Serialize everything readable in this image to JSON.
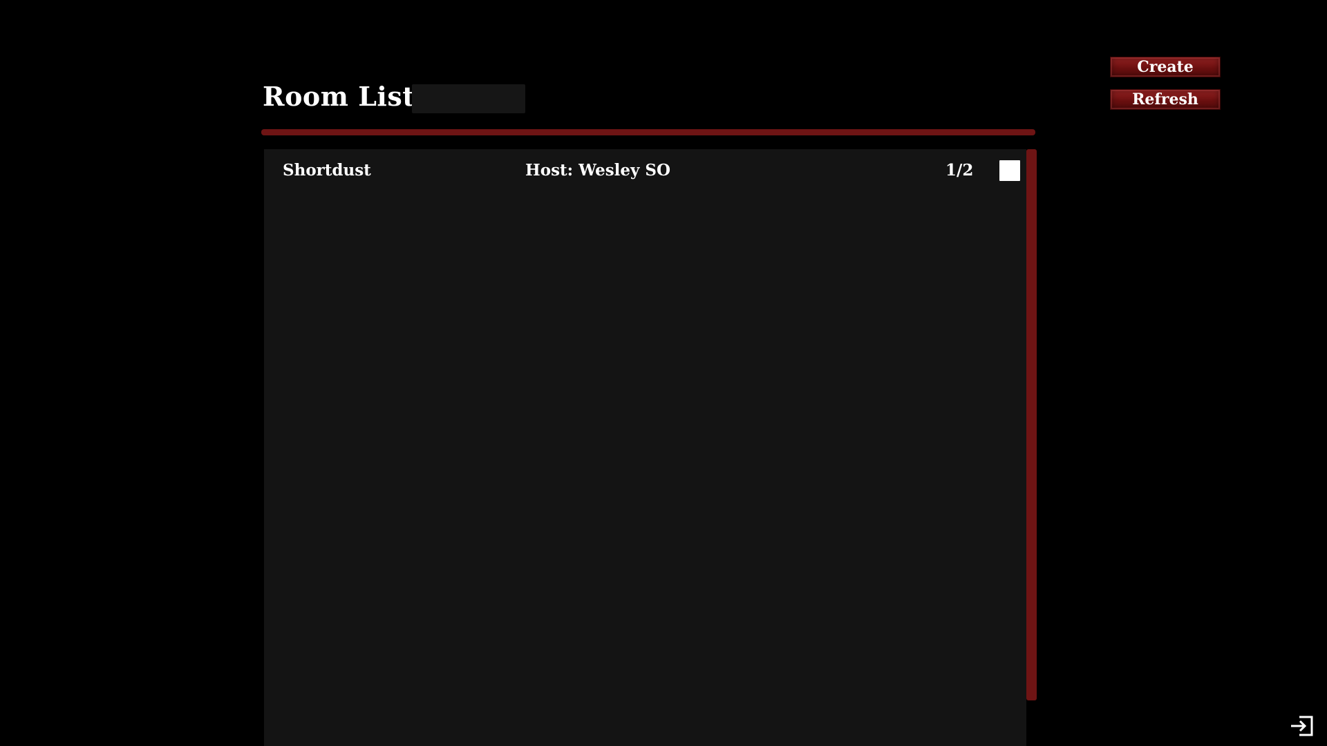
{
  "header": {
    "title": "Room List",
    "search_value": ""
  },
  "actions": {
    "create_label": "Create",
    "refresh_label": "Refresh"
  },
  "rooms": [
    {
      "name": "Shortdust",
      "host": "Host: Wesley SO",
      "players": "1/2"
    }
  ],
  "icons": {
    "exit": "exit-icon"
  },
  "colors": {
    "background": "#000000",
    "accent": "#6e1414",
    "button": "#7a1515",
    "panel": "#141414",
    "text": "#ffffff"
  }
}
